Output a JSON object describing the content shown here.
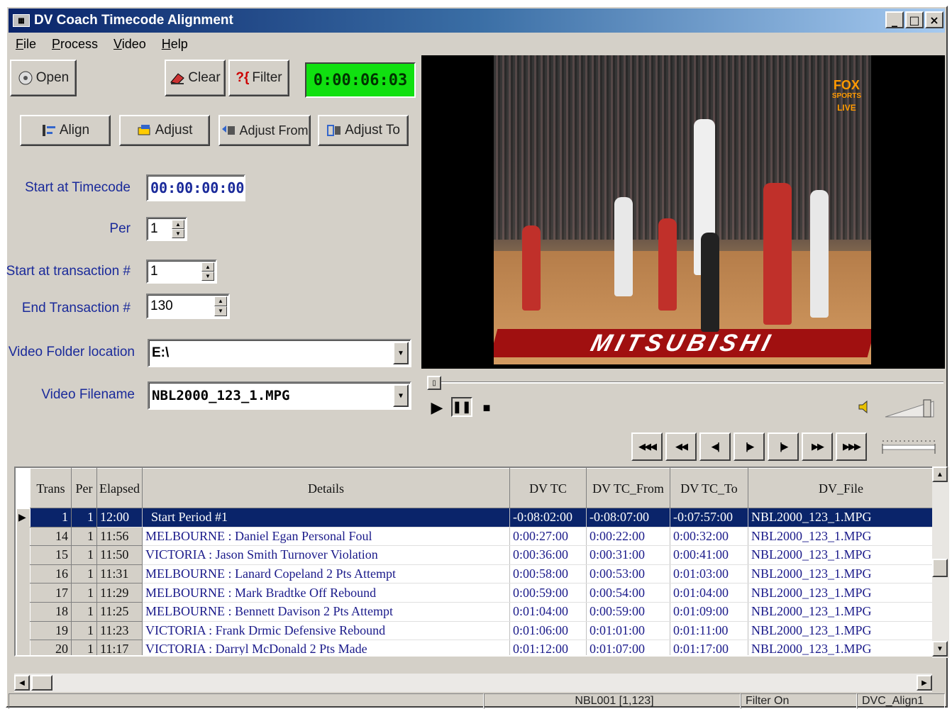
{
  "window": {
    "title": "DV Coach Timecode Alignment",
    "min": "_",
    "max": "□",
    "close": "×"
  },
  "menu": [
    "File",
    "Process",
    "Video",
    "Help"
  ],
  "toolbar": {
    "open": "Open",
    "clear": "Clear",
    "filter": "Filter",
    "timecode_display": "0:00:06:03",
    "align": "Align",
    "adjust": "Adjust",
    "adjust_from": "Adjust From",
    "adjust_to": "Adjust To"
  },
  "form": {
    "start_timecode_label": "Start at Timecode",
    "start_timecode_value": "00:00:00:00",
    "per_label": "Per",
    "per_value": "1",
    "start_transaction_label": "Start at transaction #",
    "start_transaction_value": "1",
    "end_transaction_label": "End Transaction #",
    "end_transaction_value": "130",
    "video_folder_label": "Video Folder location",
    "video_folder_value": "E:\\",
    "video_filename_label": "Video Filename",
    "video_filename_value": "NBL2000_123_1.MPG"
  },
  "video": {
    "logo_line1": "FOX",
    "logo_line2": "SPORTS",
    "logo_line3": "LIVE",
    "banner": "MITSUBISHI"
  },
  "grid": {
    "headers": [
      "Trans",
      "Per",
      "Elapsed",
      "Details",
      "DV TC",
      "DV TC_From",
      "DV TC_To",
      "DV_File"
    ],
    "rows": [
      {
        "trans": "1",
        "per": "1",
        "elapsed": "12:00",
        "details": "Start Period #1",
        "tc": "-0:08:02:00",
        "tc_from": "-0:08:07:00",
        "tc_to": "-0:07:57:00",
        "file": "NBL2000_123_1.MPG"
      },
      {
        "trans": "14",
        "per": "1",
        "elapsed": "11:56",
        "details": "MELBOURNE : Daniel Egan  Personal Foul",
        "tc": "0:00:27:00",
        "tc_from": "0:00:22:00",
        "tc_to": "0:00:32:00",
        "file": "NBL2000_123_1.MPG"
      },
      {
        "trans": "15",
        "per": "1",
        "elapsed": "11:50",
        "details": "VICTORIA : Jason Smith  Turnover  Violation",
        "tc": "0:00:36:00",
        "tc_from": "0:00:31:00",
        "tc_to": "0:00:41:00",
        "file": "NBL2000_123_1.MPG"
      },
      {
        "trans": "16",
        "per": "1",
        "elapsed": "11:31",
        "details": "MELBOURNE : Lanard Copeland  2 Pts Attempt",
        "tc": "0:00:58:00",
        "tc_from": "0:00:53:00",
        "tc_to": "0:01:03:00",
        "file": "NBL2000_123_1.MPG"
      },
      {
        "trans": "17",
        "per": "1",
        "elapsed": "11:29",
        "details": "MELBOURNE : Mark Bradtke  Off Rebound",
        "tc": "0:00:59:00",
        "tc_from": "0:00:54:00",
        "tc_to": "0:01:04:00",
        "file": "NBL2000_123_1.MPG"
      },
      {
        "trans": "18",
        "per": "1",
        "elapsed": "11:25",
        "details": "MELBOURNE : Bennett Davison  2 Pts Attempt",
        "tc": "0:01:04:00",
        "tc_from": "0:00:59:00",
        "tc_to": "0:01:09:00",
        "file": "NBL2000_123_1.MPG"
      },
      {
        "trans": "19",
        "per": "1",
        "elapsed": "11:23",
        "details": "VICTORIA : Frank Drmic  Defensive Rebound",
        "tc": "0:01:06:00",
        "tc_from": "0:01:01:00",
        "tc_to": "0:01:11:00",
        "file": "NBL2000_123_1.MPG"
      },
      {
        "trans": "20",
        "per": "1",
        "elapsed": "11:17",
        "details": "VICTORIA : Darryl McDonald  2 Pts Made",
        "tc": "0:01:12:00",
        "tc_from": "0:01:07:00",
        "tc_to": "0:01:17:00",
        "file": "NBL2000_123_1.MPG"
      }
    ]
  },
  "status": {
    "pane1": "",
    "pane2": "NBL001  [1,123]",
    "pane3": "Filter On",
    "pane4": "DVC_Align1"
  },
  "colors": {
    "accent": "#0a246a",
    "timer_bg": "#10e010",
    "label": "#1a2a9a"
  }
}
